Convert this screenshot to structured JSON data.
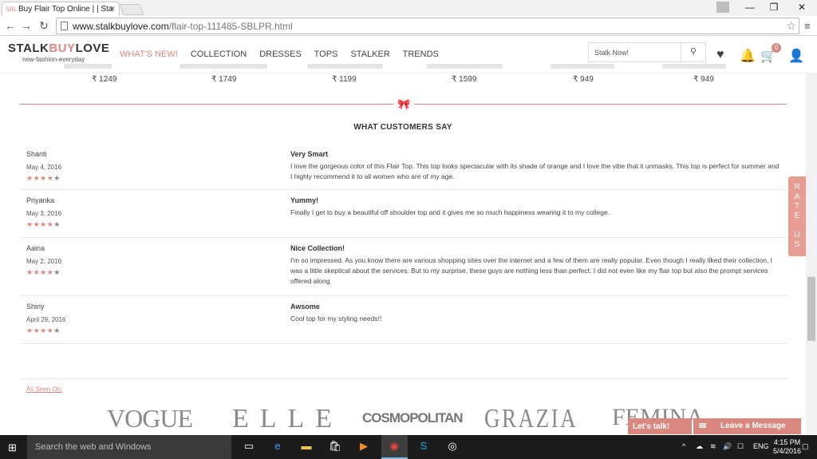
{
  "browser": {
    "tab_title": "Buy Flair Top Online | | Sta",
    "favicon_text": "SBL",
    "url_host": "www.stalkbuylove.com",
    "url_path": "/flair-top-111485-SBLPR.html"
  },
  "site": {
    "logo_stalk": "STALK",
    "logo_buy": "BUY",
    "logo_love": "LOVE",
    "tagline": "new-fashion-everyday",
    "nav": [
      "WHAT'S NEW!",
      "COLLECTION",
      "DRESSES",
      "TOPS",
      "STALKER",
      "TRENDS"
    ],
    "search_placeholder": "Stalk Now!",
    "cart_count": "0"
  },
  "products": {
    "prices": [
      "₹ 1249",
      "₹ 1749",
      "₹ 1199",
      "₹ 1599",
      "₹ 949",
      "₹ 949"
    ]
  },
  "reviews": {
    "section_title": "WHAT CUSTOMERS SAY",
    "items": [
      {
        "name": "Shanti",
        "date": "May 4, 2016",
        "rating": 4,
        "title": "Very Smart",
        "text": "I love the gorgeous color of this Flair Top. This top looks spectacular with its shade of orange and I love the vibe that it unmasks. This top is perfect for summer and I highly recommend it to all women who are of my age."
      },
      {
        "name": "Priyanka",
        "date": "May 3, 2016",
        "rating": 4,
        "title": "Yummy!",
        "text": "Finally I get to buy a beautiful off shoulder top and it gives me so much happiness wearing it to my college."
      },
      {
        "name": "Aaina",
        "date": "May 2, 2016",
        "rating": 4,
        "title": "Nice Collection!",
        "text": "I'm so impressed. As you know there are various shopping sites over the internet and a few of them are really popular. Even though I really liked their collection, I was a little skeptical about the services. But to my surprise, these guys are nothing less than perfect. I did not even like my flair top but also the prompt services offered along"
      },
      {
        "name": "Shiny",
        "date": "April 29, 2016",
        "rating": 4,
        "title": "Awsome",
        "text": "Cool top for my styling needs!!"
      }
    ]
  },
  "seen_on": {
    "label": "As Seen On:",
    "brands": [
      "VOGUE",
      "ELLE",
      "COSMOPOLITAN",
      "GRAZIA",
      "FEMINA"
    ]
  },
  "widgets": {
    "rate_us": "R A T E U S",
    "lets_talk": "Let's talk!",
    "leave_message": "Leave a Message"
  },
  "taskbar": {
    "search_placeholder": "Search the web and Windows",
    "lang": "ENG",
    "time": "4:15 PM",
    "date": "5/4/2016"
  },
  "colors": {
    "accent": "#d9877f"
  }
}
